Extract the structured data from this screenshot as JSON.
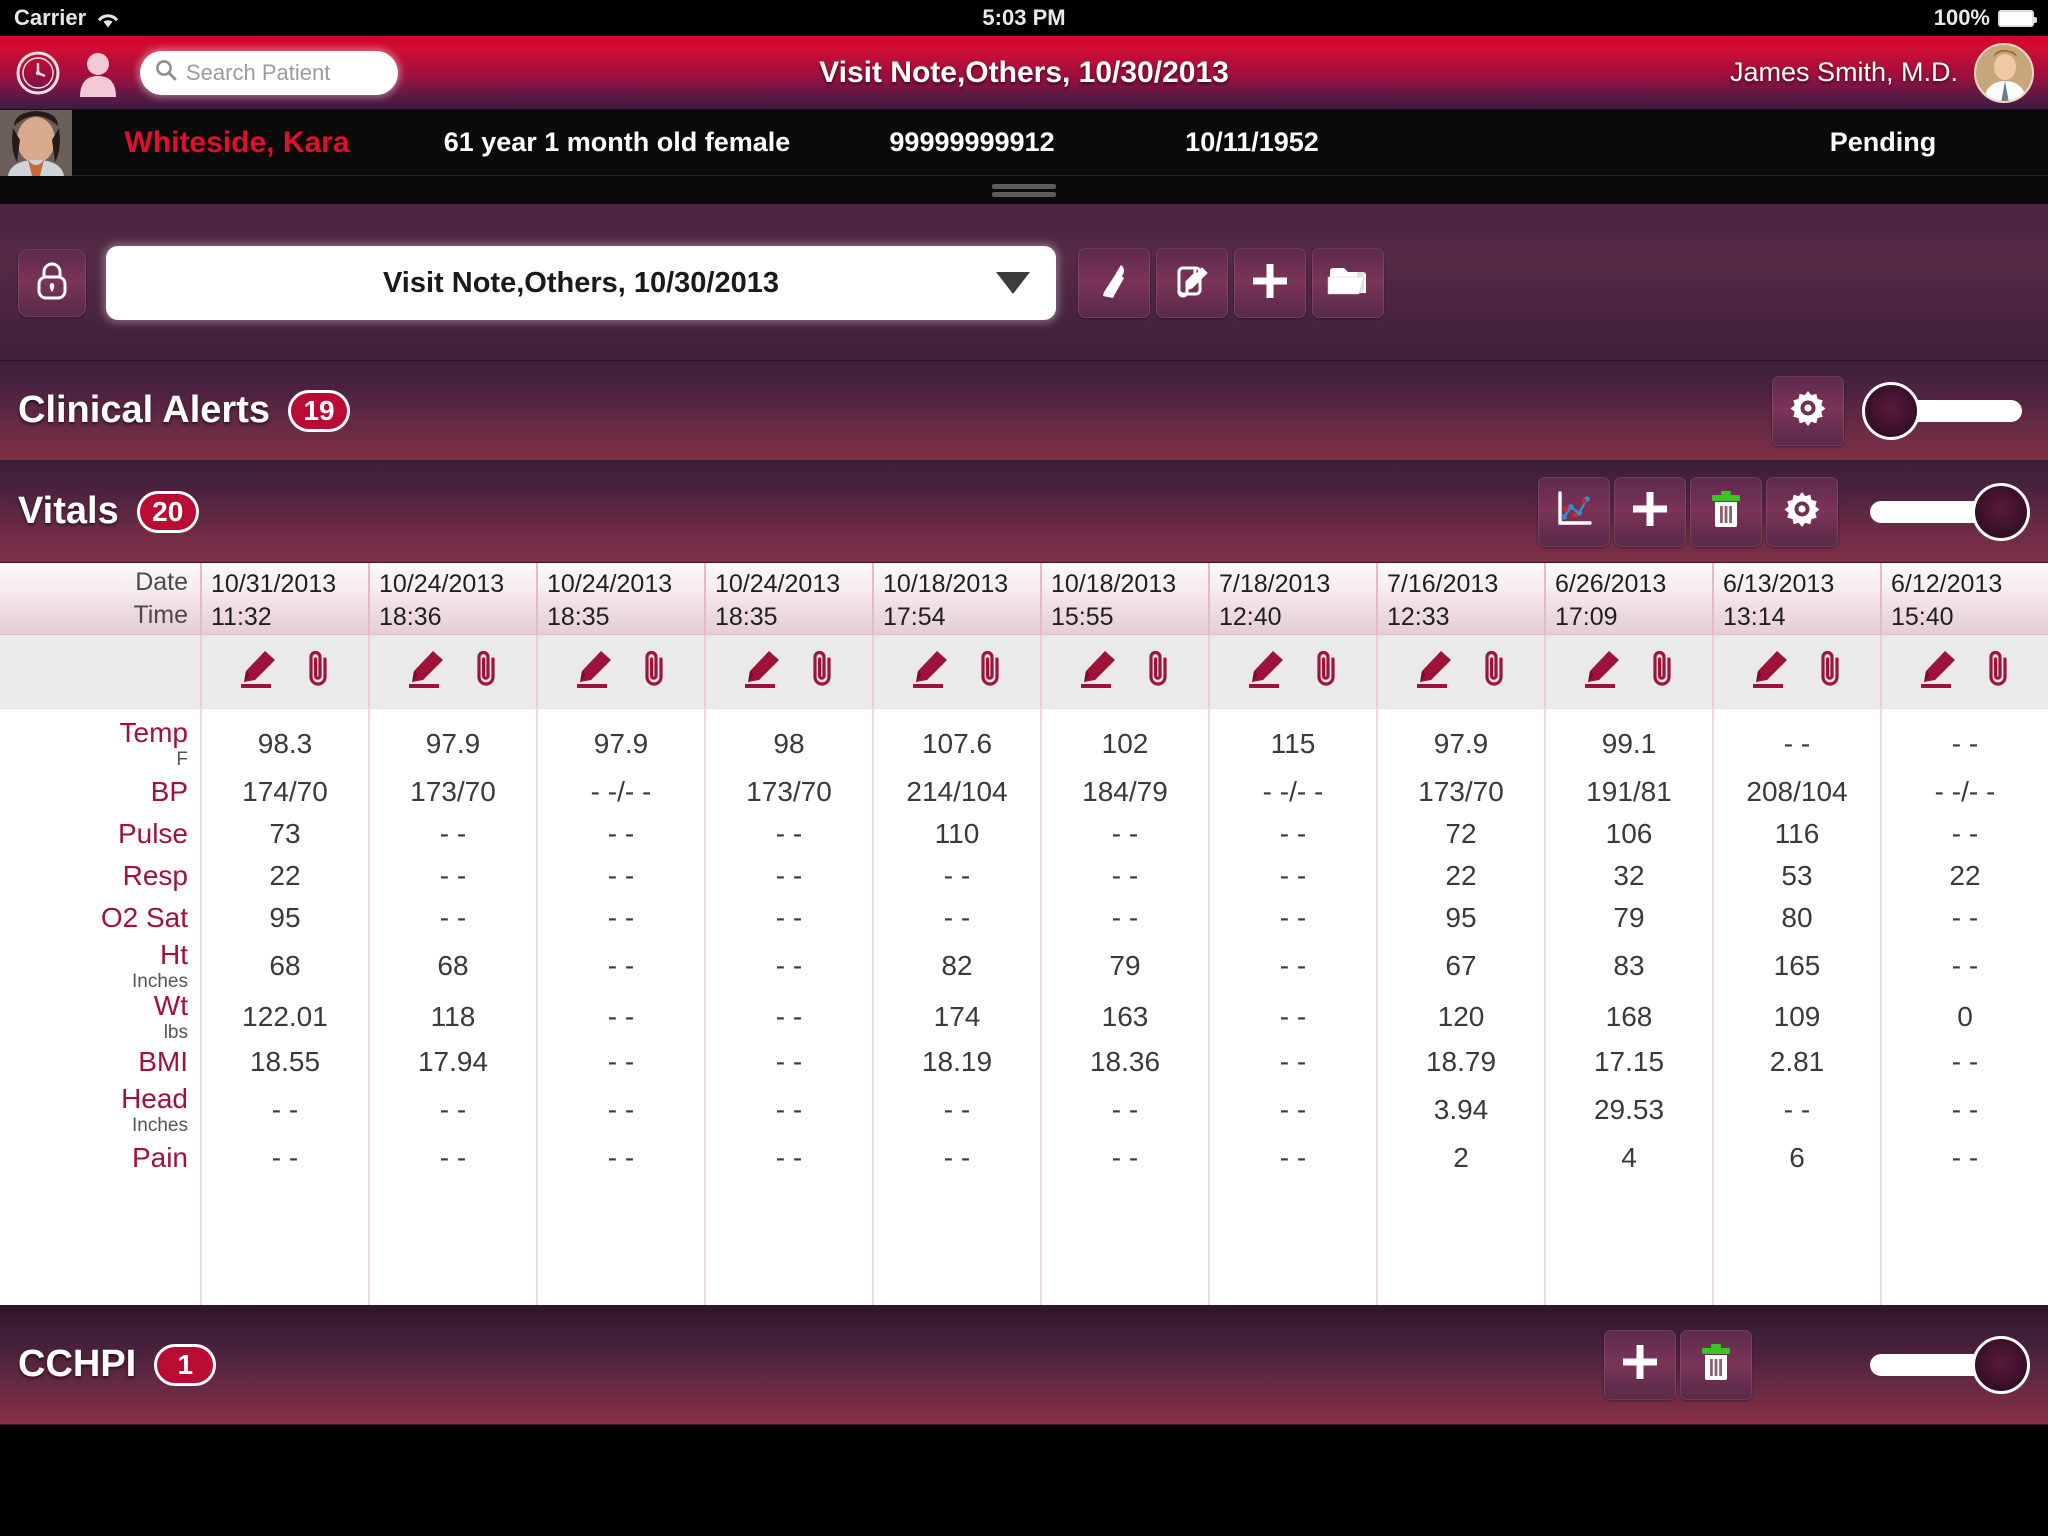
{
  "status_bar": {
    "carrier": "Carrier",
    "wifi_icon": "wifi-icon",
    "time": "5:03 PM",
    "battery_percent": "100%",
    "battery_icon": "battery-icon"
  },
  "navbar": {
    "clock_icon": "clock-icon",
    "person_icon": "person-icon",
    "search_placeholder": "Search Patient",
    "search_value": "",
    "search_icon": "search-icon",
    "title": "Visit Note,Others, 10/30/2013",
    "doctor_name": "James Smith, M.D.",
    "avatar_icon": "doctor-avatar"
  },
  "patient_bar": {
    "photo_icon": "patient-photo",
    "name": "Whiteside, Kara",
    "age": "61 year 1 month old female",
    "mrn": "99999999912",
    "dob": "10/11/1952",
    "status": "Pending"
  },
  "note_toolbar": {
    "lock_icon": "lock-icon",
    "selected_note": "Visit Note,Others, 10/30/2013",
    "caret_icon": "chevron-down-icon",
    "buttons": [
      {
        "icon": "broom-icon",
        "name": "clear-note-button"
      },
      {
        "icon": "edit-document-icon",
        "name": "edit-note-button"
      },
      {
        "icon": "plus-icon",
        "name": "add-note-button"
      },
      {
        "icon": "folder-icon",
        "name": "open-folder-button"
      }
    ]
  },
  "clinical_alerts": {
    "title": "Clinical Alerts",
    "count": "19",
    "gear_icon": "gear-icon",
    "slider_position": "left"
  },
  "vitals": {
    "title": "Vitals",
    "count": "20",
    "buttons": [
      {
        "icon": "chart-icon",
        "name": "vitals-graph-button"
      },
      {
        "icon": "plus-icon",
        "name": "vitals-add-button"
      },
      {
        "icon": "trash-icon",
        "name": "vitals-delete-button"
      },
      {
        "icon": "gear-icon",
        "name": "vitals-settings-button"
      }
    ],
    "slider_position": "right"
  },
  "cchpi": {
    "title": "CCHPI",
    "count": "1",
    "buttons": [
      {
        "icon": "plus-icon",
        "name": "cchpi-add-button"
      },
      {
        "icon": "trash-icon",
        "name": "cchpi-delete-button"
      }
    ],
    "slider_position": "right"
  },
  "vitals_table": {
    "corner_labels": {
      "date": "Date",
      "time": "Time"
    },
    "row_edit_icon": "pencil-edit-icon",
    "row_attach_icon": "paperclip-icon",
    "columns": [
      {
        "date": "10/31/2013",
        "time": "11:32"
      },
      {
        "date": "10/24/2013",
        "time": "18:36"
      },
      {
        "date": "10/24/2013",
        "time": "18:35"
      },
      {
        "date": "10/24/2013",
        "time": "18:35"
      },
      {
        "date": "10/18/2013",
        "time": "17:54"
      },
      {
        "date": "10/18/2013",
        "time": "15:55"
      },
      {
        "date": "7/18/2013",
        "time": "12:40"
      },
      {
        "date": "7/16/2013",
        "time": "12:33"
      },
      {
        "date": "6/26/2013",
        "time": "17:09"
      },
      {
        "date": "6/13/2013",
        "time": "13:14"
      },
      {
        "date": "6/12/2013",
        "time": "15:40"
      }
    ],
    "rows": [
      {
        "label": "Temp",
        "unit": "F",
        "values": [
          "98.3",
          "97.9",
          "97.9",
          "98",
          "107.6",
          "102",
          "115",
          "97.9",
          "99.1",
          "- -",
          "- -"
        ]
      },
      {
        "label": "BP",
        "unit": "",
        "values": [
          "174/70",
          "173/70",
          "- -/- -",
          "173/70",
          "214/104",
          "184/79",
          "- -/- -",
          "173/70",
          "191/81",
          "208/104",
          "- -/- -"
        ]
      },
      {
        "label": "Pulse",
        "unit": "",
        "values": [
          "73",
          "- -",
          "- -",
          "- -",
          "110",
          "- -",
          "- -",
          "72",
          "106",
          "116",
          "- -"
        ]
      },
      {
        "label": "Resp",
        "unit": "",
        "values": [
          "22",
          "- -",
          "- -",
          "- -",
          "- -",
          "- -",
          "- -",
          "22",
          "32",
          "53",
          "22"
        ]
      },
      {
        "label": "O2 Sat",
        "unit": "",
        "values": [
          "95",
          "- -",
          "- -",
          "- -",
          "- -",
          "- -",
          "- -",
          "95",
          "79",
          "80",
          "- -"
        ]
      },
      {
        "label": "Ht",
        "unit": "Inches",
        "values": [
          "68",
          "68",
          "- -",
          "- -",
          "82",
          "79",
          "- -",
          "67",
          "83",
          "165",
          "- -"
        ]
      },
      {
        "label": "Wt",
        "unit": "lbs",
        "values": [
          "122.01",
          "118",
          "- -",
          "- -",
          "174",
          "163",
          "- -",
          "120",
          "168",
          "109",
          "0"
        ]
      },
      {
        "label": "BMI",
        "unit": "",
        "values": [
          "18.55",
          "17.94",
          "- -",
          "- -",
          "18.19",
          "18.36",
          "- -",
          "18.79",
          "17.15",
          "2.81",
          "- -"
        ]
      },
      {
        "label": "Head",
        "unit": "Inches",
        "values": [
          "- -",
          "- -",
          "- -",
          "- -",
          "- -",
          "- -",
          "- -",
          "3.94",
          "29.53",
          "- -",
          "- -"
        ]
      },
      {
        "label": "Pain",
        "unit": "",
        "values": [
          "- -",
          "- -",
          "- -",
          "- -",
          "- -",
          "- -",
          "- -",
          "2",
          "4",
          "6",
          "- -"
        ]
      }
    ]
  },
  "colors": {
    "brand_red": "#b80c35",
    "patient_name_red": "#e10e2e",
    "row_label_red": "#9f1239",
    "accent_green": "#3cc423"
  }
}
